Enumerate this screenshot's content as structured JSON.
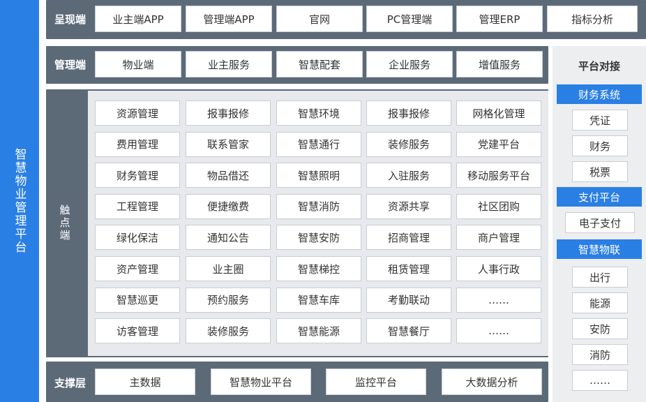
{
  "left_title": "智慧物业管理平台",
  "presentation": {
    "label": "呈现端",
    "items": [
      "业主端APP",
      "管理端APP",
      "官网",
      "PC管理端",
      "管理ERP",
      "指标分析"
    ]
  },
  "management": {
    "label": "管理端",
    "items": [
      "物业端",
      "业主服务",
      "智慧配套",
      "企业服务",
      "增值服务"
    ]
  },
  "touchpoint": {
    "label": "触点端",
    "rows": [
      [
        "资源管理",
        "报事报修",
        "智慧环境",
        "报事报修",
        "网格化管理"
      ],
      [
        "费用管理",
        "联系管家",
        "智慧通行",
        "装修服务",
        "党建平台"
      ],
      [
        "财务管理",
        "物品借还",
        "智慧照明",
        "入驻服务",
        "移动服务平台"
      ],
      [
        "工程管理",
        "便捷缴费",
        "智慧消防",
        "资源共享",
        "社区团购"
      ],
      [
        "绿化保洁",
        "通知公告",
        "智慧安防",
        "招商管理",
        "商户管理"
      ],
      [
        "资产管理",
        "业主圈",
        "智慧梯控",
        "租赁管理",
        "人事行政"
      ],
      [
        "智慧巡更",
        "预约服务",
        "智慧车库",
        "考勤联动",
        "……"
      ],
      [
        "访客管理",
        "装修服务",
        "智慧能源",
        "智慧餐厅",
        "……"
      ]
    ]
  },
  "support": {
    "label": "支撑层",
    "items": [
      "主数据",
      "智慧物业平台",
      "监控平台",
      "大数据分析"
    ]
  },
  "platform": {
    "title": "平台对接",
    "groups": [
      {
        "head": "财务系统",
        "items": [
          "凭证",
          "财务",
          "税票"
        ]
      },
      {
        "head": "支付平台",
        "items": [
          "电子支付"
        ]
      },
      {
        "head": "智慧物联",
        "items": [
          "出行",
          "能源",
          "安防",
          "消防",
          "……"
        ]
      }
    ]
  }
}
